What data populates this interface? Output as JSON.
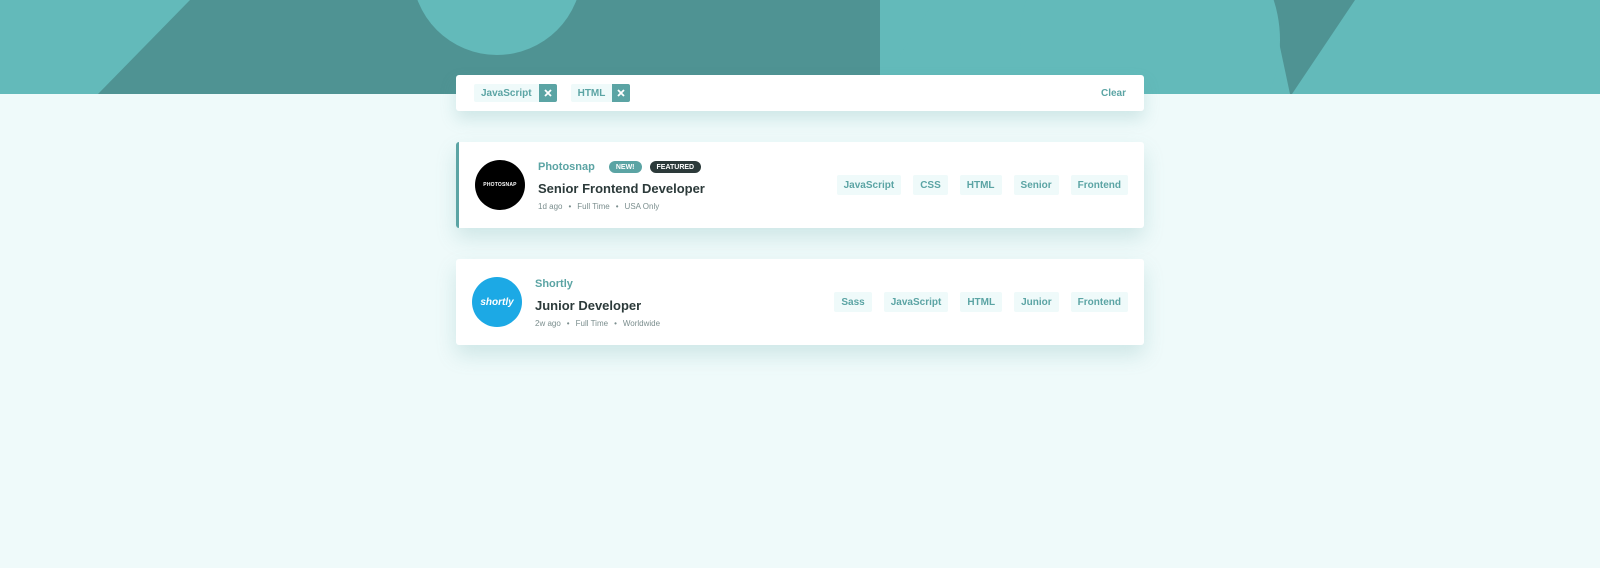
{
  "colors": {
    "primary": "#5ba4a4",
    "header_dark": "#4f9393",
    "header_light": "#63baba",
    "background": "#effafa",
    "dark_text": "#2c3a3a",
    "muted_text": "#7b8e8e",
    "featured_badge": "#2c3a3a",
    "shortly_brand": "#1ca9e5"
  },
  "filter_bar": {
    "chips": [
      {
        "label": "JavaScript",
        "remove_icon": "close-icon"
      },
      {
        "label": "HTML",
        "remove_icon": "close-icon"
      }
    ],
    "clear_label": "Clear"
  },
  "jobs": [
    {
      "company": "Photosnap",
      "logo_text": "PHOTOSNAP",
      "badge_new": "NEW!",
      "badge_featured": "FEATURED",
      "position": "Senior Frontend Developer",
      "posted": "1d ago",
      "contract": "Full Time",
      "location": "USA Only",
      "tags": [
        "JavaScript",
        "CSS",
        "HTML",
        "Senior",
        "Frontend"
      ]
    },
    {
      "company": "Shortly",
      "logo_text": "shortly",
      "position": "Junior Developer",
      "posted": "2w ago",
      "contract": "Full Time",
      "location": "Worldwide",
      "tags": [
        "Sass",
        "JavaScript",
        "HTML",
        "Junior",
        "Frontend"
      ]
    }
  ],
  "separator": "•"
}
